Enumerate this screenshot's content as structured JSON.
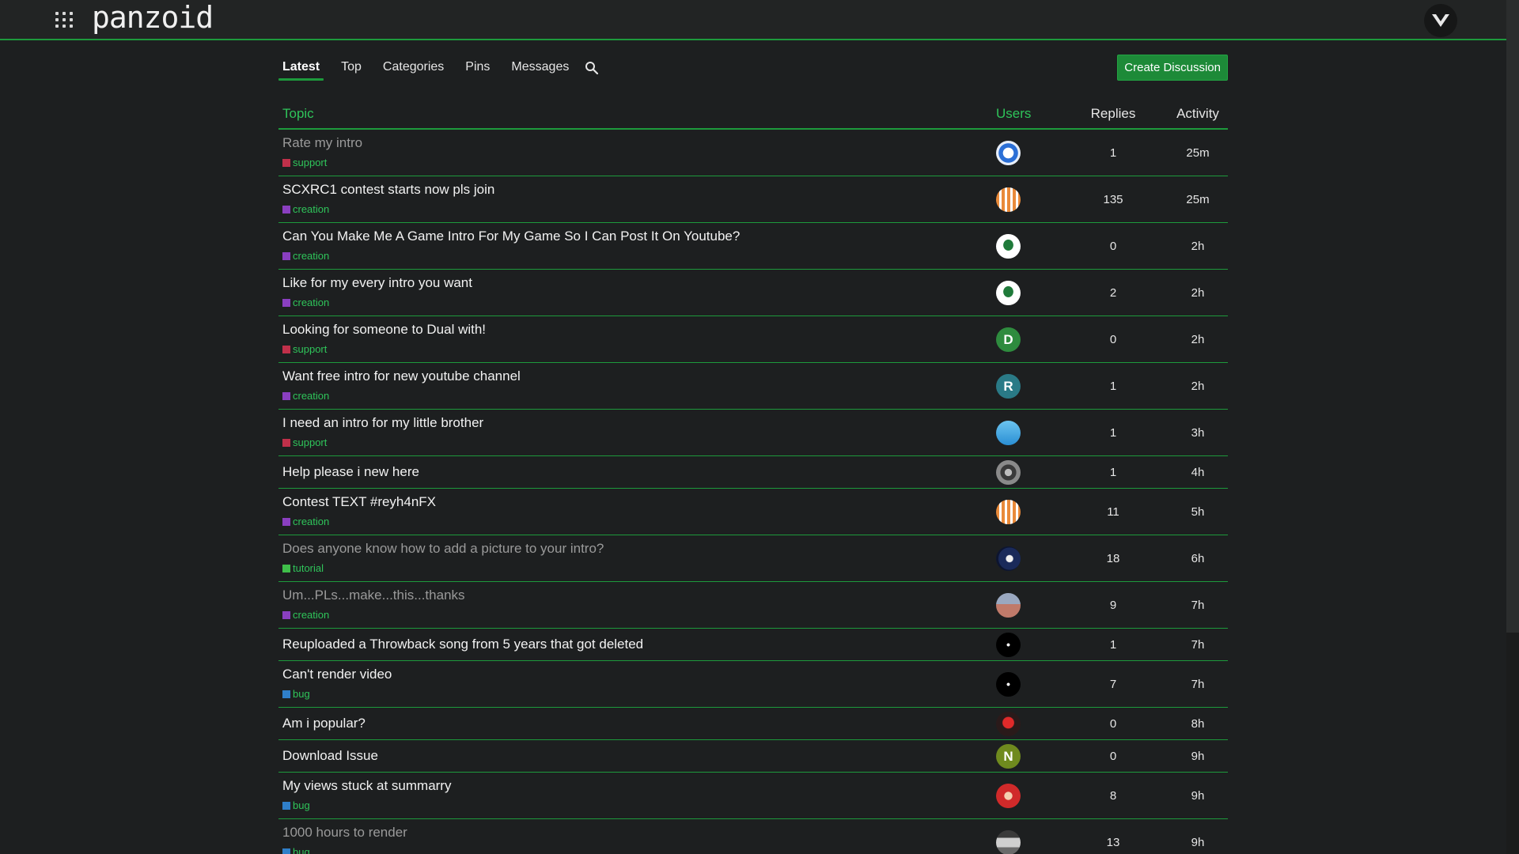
{
  "header": {
    "logo": "panzoid",
    "apps_icon": "grid-icon",
    "profile_icon": "chevron-emblem-icon"
  },
  "nav": {
    "tabs": [
      {
        "label": "Latest",
        "active": true
      },
      {
        "label": "Top"
      },
      {
        "label": "Categories"
      },
      {
        "label": "Pins"
      },
      {
        "label": "Messages"
      }
    ],
    "search_icon": "search-icon",
    "create_button": "Create Discussion"
  },
  "table": {
    "headers": {
      "topic": "Topic",
      "users": "Users",
      "replies": "Replies",
      "activity": "Activity"
    },
    "rows": [
      {
        "title": "Rate my intro",
        "category": "support",
        "replies": "1",
        "activity": "25m",
        "read": true
      },
      {
        "title": "SCXRC1 contest starts now pls join",
        "category": "creation",
        "replies": "135",
        "activity": "25m"
      },
      {
        "title": "Can You Make Me A Game Intro For My Game So I Can Post It On Youtube?",
        "category": "creation",
        "replies": "0",
        "activity": "2h"
      },
      {
        "title": "Like for my every intro you want",
        "category": "creation",
        "replies": "2",
        "activity": "2h"
      },
      {
        "title": "Looking for someone to Dual with!",
        "category": "support",
        "replies": "0",
        "activity": "2h",
        "avatar_letter": "D"
      },
      {
        "title": "Want free intro for new youtube channel",
        "category": "creation",
        "replies": "1",
        "activity": "2h",
        "avatar_letter": "R"
      },
      {
        "title": "I need an intro for my little brother",
        "category": "support",
        "replies": "1",
        "activity": "3h"
      },
      {
        "title": "Help please i new here",
        "category": "",
        "replies": "1",
        "activity": "4h"
      },
      {
        "title": "Contest TEXT #reyh4nFX",
        "category": "creation",
        "replies": "11",
        "activity": "5h"
      },
      {
        "title": "Does anyone know how to add a picture to your intro?",
        "category": "tutorial",
        "replies": "18",
        "activity": "6h",
        "read": true
      },
      {
        "title": "Um...PLs...make...this...thanks",
        "category": "creation",
        "replies": "9",
        "activity": "7h",
        "read": true
      },
      {
        "title": "Reuploaded a Throwback song from 5 years that got deleted",
        "category": "",
        "replies": "1",
        "activity": "7h"
      },
      {
        "title": "Can't render video",
        "category": "bug",
        "replies": "7",
        "activity": "7h"
      },
      {
        "title": "Am i popular?",
        "category": "",
        "replies": "0",
        "activity": "8h"
      },
      {
        "title": "Download Issue",
        "category": "",
        "replies": "0",
        "activity": "9h",
        "avatar_letter": "N"
      },
      {
        "title": "My views stuck at summarry",
        "category": "bug",
        "replies": "8",
        "activity": "9h"
      },
      {
        "title": "1000 hours to render",
        "category": "bug",
        "replies": "13",
        "activity": "9h",
        "read": true
      }
    ]
  },
  "colors": {
    "accent": "#1d9a3c",
    "accent_text": "#2fc45a",
    "background": "#1d1f20",
    "category_support": "#c0304a",
    "category_creation": "#8a3fc0",
    "category_tutorial": "#3fbf4a",
    "category_bug": "#2f7fc9"
  }
}
